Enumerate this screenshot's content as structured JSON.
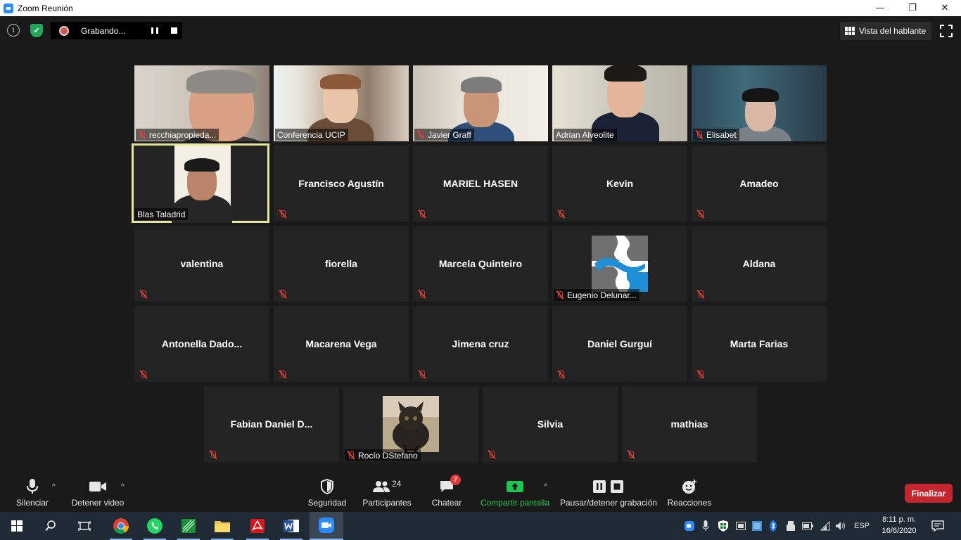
{
  "window": {
    "title": "Zoom Reunión",
    "minimize": "—",
    "restore": "❐",
    "close": "✕"
  },
  "topbar": {
    "info_glyph": "i",
    "shield_glyph": "✔",
    "recording_label": "Grabando...",
    "speaker_view_label": "Vista del hablante"
  },
  "participants": [
    {
      "name": "recchiapropieda...",
      "video": true,
      "muted": true
    },
    {
      "name": "Conferencia UCIP",
      "video": true,
      "muted": false
    },
    {
      "name": "Javier Graff",
      "video": true,
      "muted": true
    },
    {
      "name": "Adrian Alveolite",
      "video": true,
      "muted": false
    },
    {
      "name": "Elisabet",
      "video": true,
      "muted": true
    },
    {
      "name": "Blas Taladrid",
      "video": true,
      "muted": false,
      "active_speaker": true
    },
    {
      "name": "Francisco Agustín",
      "video": false,
      "muted": true
    },
    {
      "name": "MARIEL HASEN",
      "video": false,
      "muted": true
    },
    {
      "name": "Kevin",
      "video": false,
      "muted": true
    },
    {
      "name": "Amadeo",
      "video": false,
      "muted": true
    },
    {
      "name": "valentina",
      "video": false,
      "muted": true
    },
    {
      "name": "fiorella",
      "video": false,
      "muted": true
    },
    {
      "name": "Marcela Quinteiro",
      "video": false,
      "muted": true
    },
    {
      "name": "Eugenio Delunar...",
      "video": false,
      "avatar": "logo",
      "muted": true
    },
    {
      "name": "Aldana",
      "video": false,
      "muted": true
    },
    {
      "name": "Antonella  Dado...",
      "video": false,
      "muted": true
    },
    {
      "name": "Macarena Vega",
      "video": false,
      "muted": true
    },
    {
      "name": "Jimena cruz",
      "video": false,
      "muted": true
    },
    {
      "name": "Daniel Gurguí",
      "video": false,
      "muted": true
    },
    {
      "name": "Marta Farias",
      "video": false,
      "muted": true
    },
    {
      "name": "Fabian  Daniel  D...",
      "video": false,
      "muted": true
    },
    {
      "name": "Rocío DStefano",
      "video": false,
      "avatar": "cat",
      "muted": true
    },
    {
      "name": "Silvia",
      "video": false,
      "muted": true
    },
    {
      "name": "mathias",
      "video": false,
      "muted": true
    }
  ],
  "toolbar": {
    "mute_label": "Silenciar",
    "video_label": "Detener video",
    "security_label": "Seguridad",
    "participants_label": "Participantes",
    "participants_count": "24",
    "chat_label": "Chatear",
    "chat_badge": "7",
    "share_label": "Compartir pantalla",
    "record_label": "Pausar/detener grabación",
    "reactions_label": "Reacciones",
    "end_label": "Finalizar",
    "caret": "^"
  },
  "taskbar": {
    "language": "ESP",
    "time": "8:11 p. m.",
    "date": "16/6/2020",
    "apps": [
      "windows-start",
      "search",
      "task-view",
      "chrome",
      "whatsapp",
      "green-app",
      "file-explorer",
      "acrobat",
      "word",
      "zoom"
    ]
  },
  "colors": {
    "accent_green": "#23c552",
    "end_red": "#c4262e",
    "active_speaker_border": "#e5e69a",
    "zoom_blue": "#2d8cff"
  }
}
